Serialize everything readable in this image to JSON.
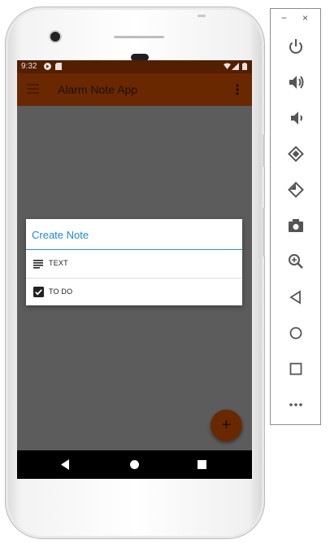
{
  "status_bar": {
    "time": "9:32"
  },
  "app_bar": {
    "title": "Alarm Note App"
  },
  "dialog": {
    "title": "Create Note",
    "options": [
      {
        "label": "TEXT",
        "icon": "notes-lines-icon"
      },
      {
        "label": "TO DO",
        "icon": "checkbox-checked-icon"
      }
    ]
  },
  "fab": {
    "label": "+"
  },
  "emulator_panel": {
    "minimize": "−",
    "close": "×",
    "buttons": [
      "power-icon",
      "volume-up-icon",
      "volume-down-icon",
      "rotate-left-icon",
      "rotate-right-icon",
      "camera-icon",
      "zoom-icon",
      "back-icon",
      "home-icon",
      "overview-icon",
      "more-icon"
    ]
  },
  "colors": {
    "status_bar": "#521f00",
    "app_bar": "#6a2800",
    "scrim": "#5c5c5c",
    "accent": "#1e88d6"
  }
}
